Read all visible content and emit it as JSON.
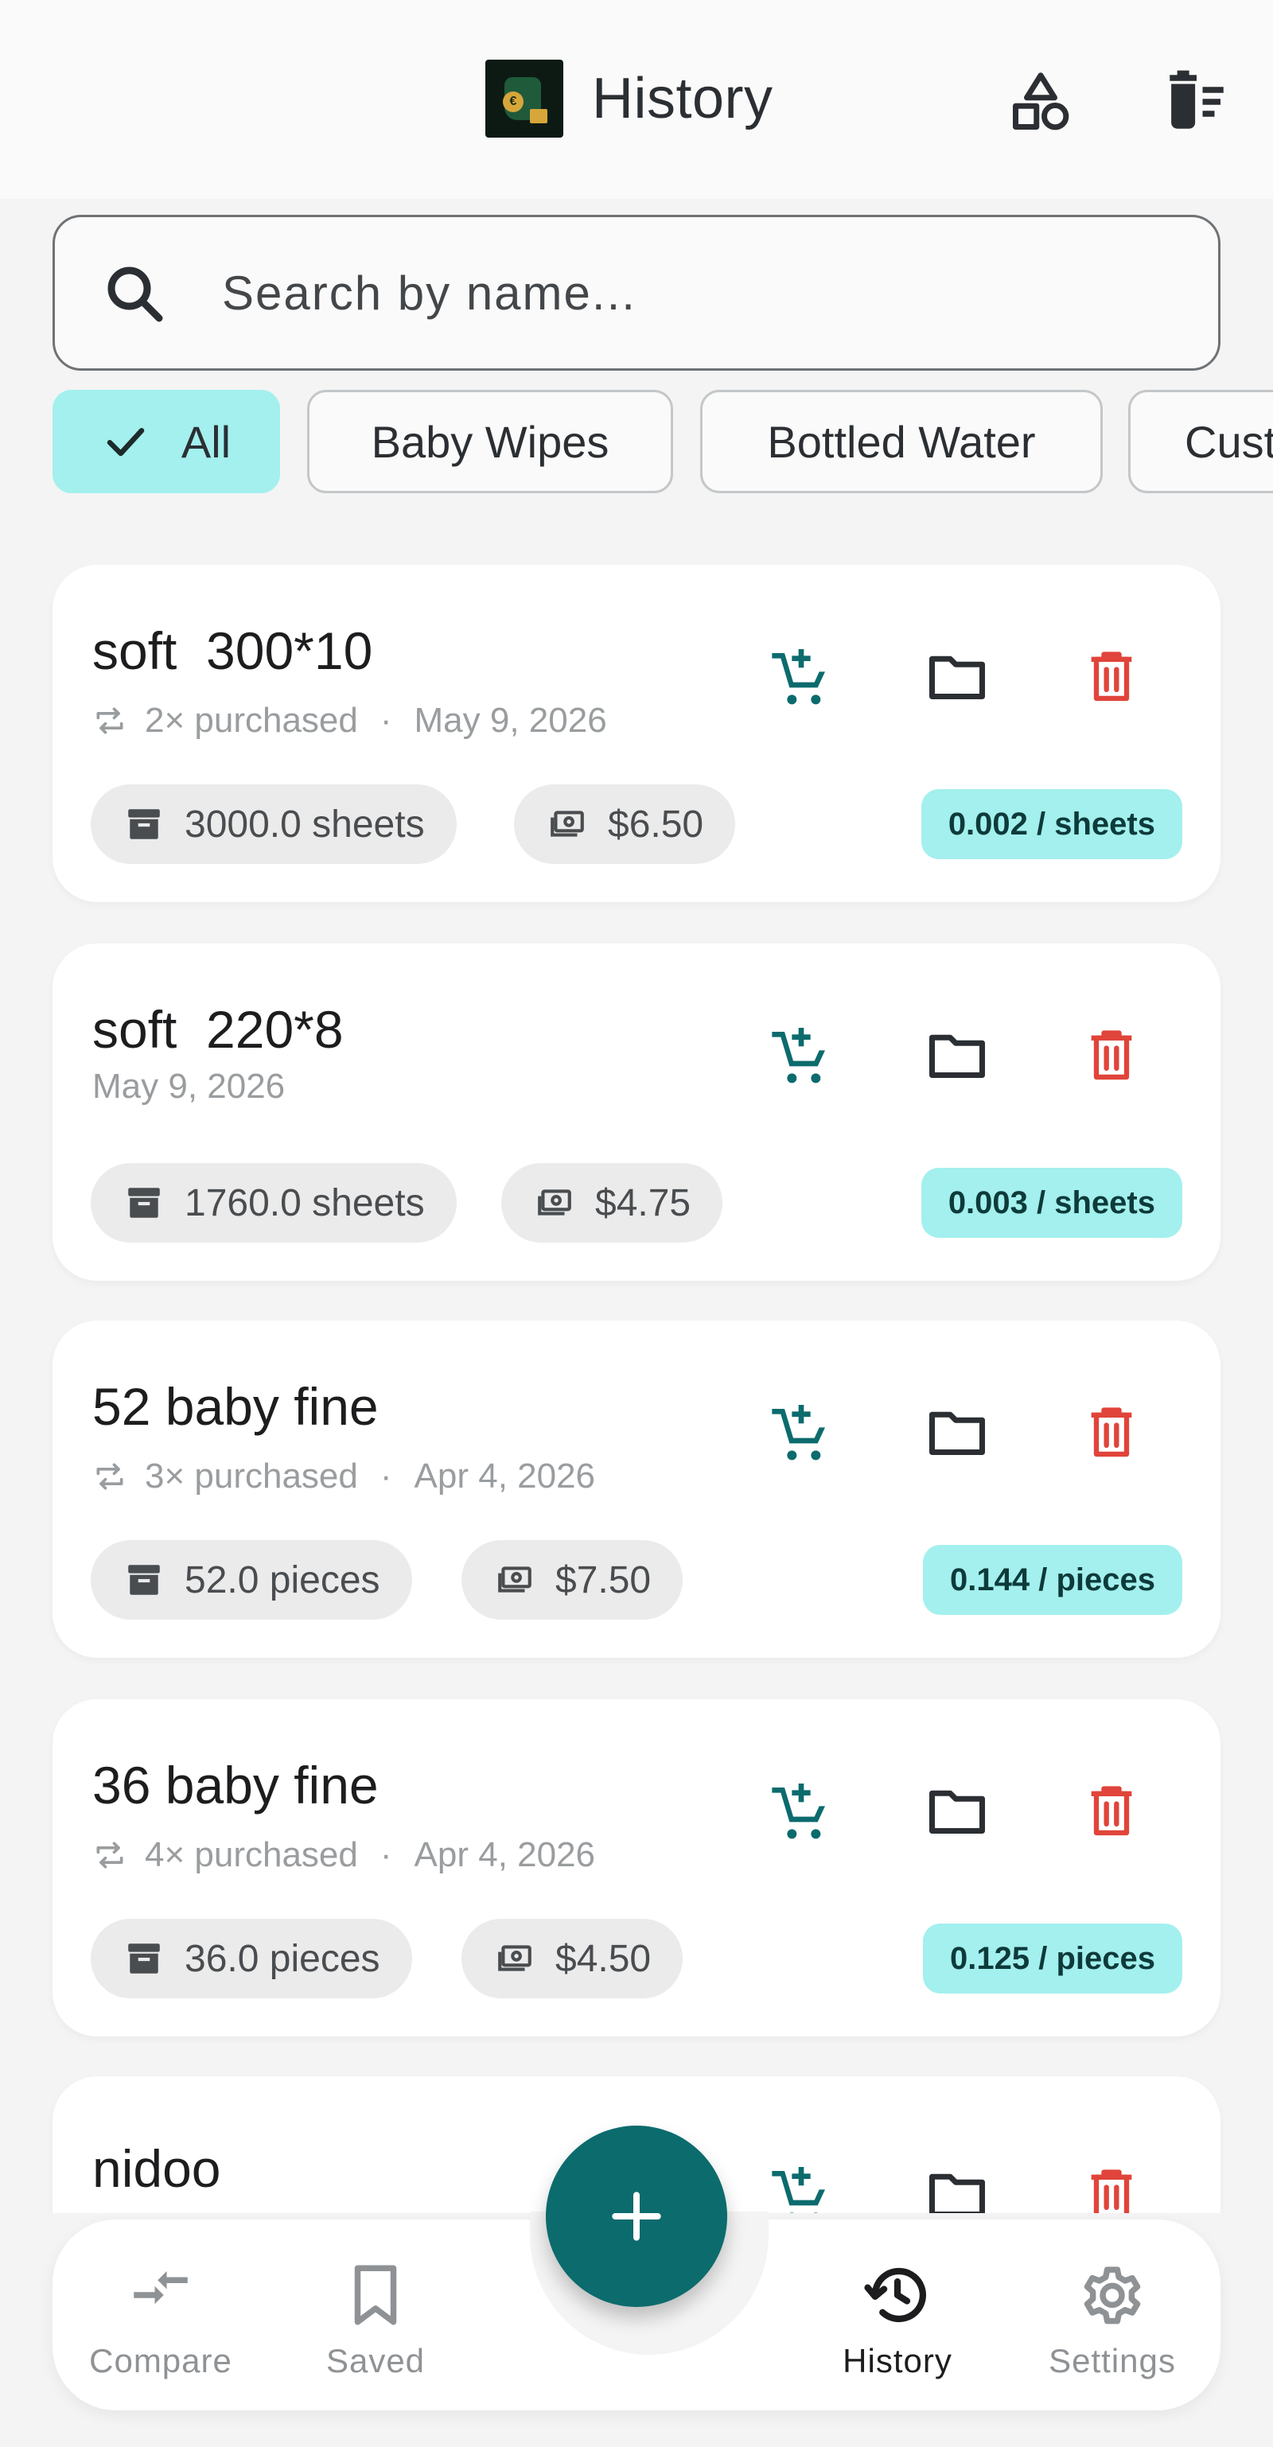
{
  "header": {
    "title": "History",
    "logo_mark": "€"
  },
  "search": {
    "placeholder": "Search by name..."
  },
  "filters": [
    {
      "label": "All",
      "selected": true
    },
    {
      "label": "Baby Wipes",
      "selected": false
    },
    {
      "label": "Bottled Water",
      "selected": false
    },
    {
      "label": "Cust",
      "selected": false
    }
  ],
  "items": [
    {
      "name": "soft  300*10",
      "purchased": "2× purchased",
      "separator": "·",
      "date": "May 9, 2026",
      "quantity": "3000.0 sheets",
      "price": "$6.50",
      "unit_price": "0.002 / sheets"
    },
    {
      "name": "soft  220*8",
      "purchased": "",
      "separator": "",
      "date": "May 9, 2026",
      "quantity": "1760.0 sheets",
      "price": "$4.75",
      "unit_price": "0.003 / sheets"
    },
    {
      "name": "52 baby fine",
      "purchased": "3× purchased",
      "separator": "·",
      "date": "Apr 4, 2026",
      "quantity": "52.0 pieces",
      "price": "$7.50",
      "unit_price": "0.144 / pieces"
    },
    {
      "name": "36 baby fine",
      "purchased": "4× purchased",
      "separator": "·",
      "date": "Apr 4, 2026",
      "quantity": "36.0 pieces",
      "price": "$4.50",
      "unit_price": "0.125 / pieces"
    },
    {
      "name": "nidoo"
    }
  ],
  "nav": {
    "compare": "Compare",
    "saved": "Saved",
    "history": "History",
    "settings": "Settings",
    "fab_label": "+"
  },
  "colors": {
    "accent": "#0c6b6d",
    "chip_selected": "#a3f0ee",
    "delete": "#e0443a",
    "cart": "#0c6b6d"
  }
}
